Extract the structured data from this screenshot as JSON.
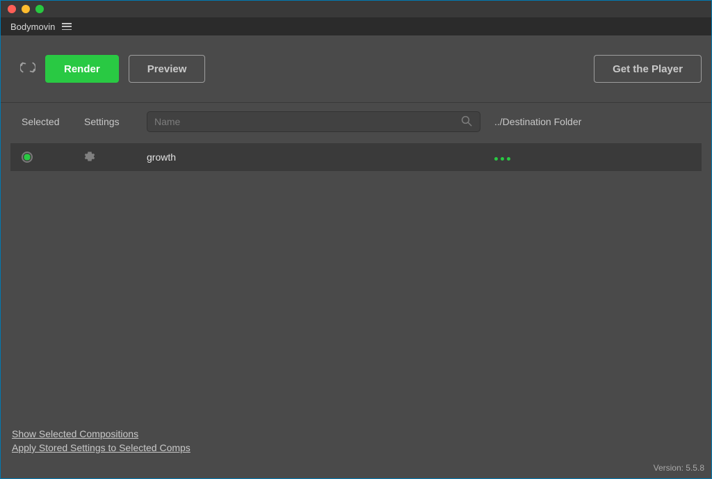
{
  "app": {
    "title": "Bodymovin"
  },
  "toolbar": {
    "render_label": "Render",
    "preview_label": "Preview",
    "get_player_label": "Get the Player"
  },
  "columns": {
    "selected": "Selected",
    "settings": "Settings",
    "name_placeholder": "Name",
    "destination": "../Destination Folder"
  },
  "rows": [
    {
      "name": "growth",
      "selected": true
    }
  ],
  "footer": {
    "show_selected": "Show Selected Compositions",
    "apply_stored": "Apply Stored Settings to Selected Comps",
    "version": "Version: 5.5.8"
  },
  "colors": {
    "accent": "#29c943"
  }
}
